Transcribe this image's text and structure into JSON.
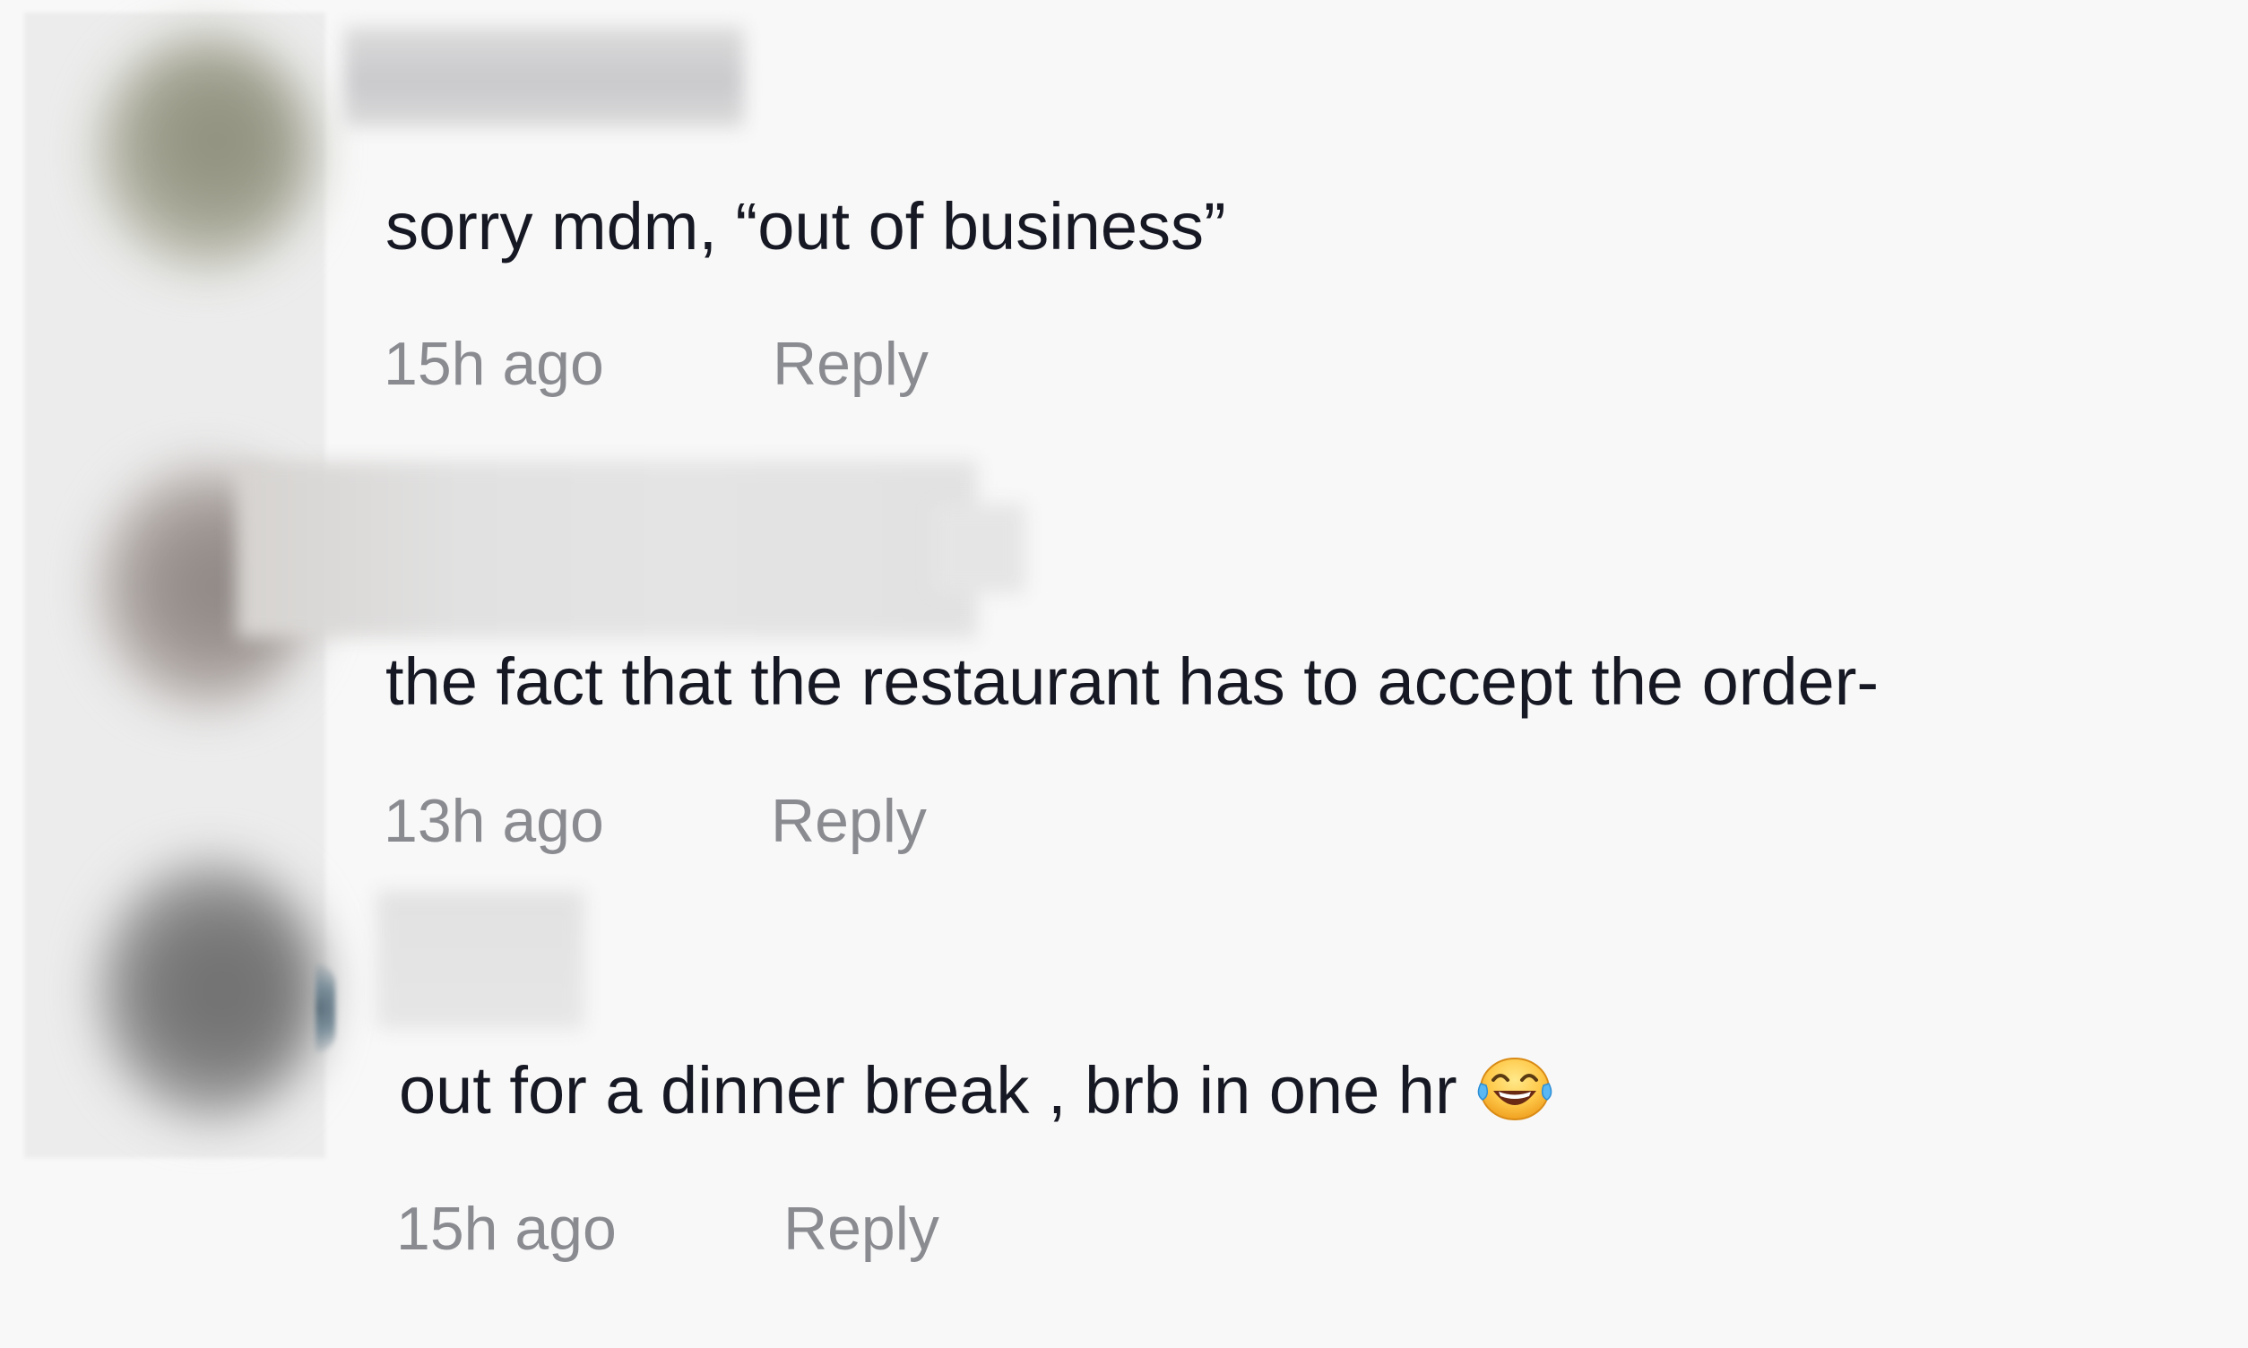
{
  "comments": [
    {
      "text": "sorry mdm, “out of business”",
      "time": "15h ago",
      "reply_label": "Reply"
    },
    {
      "text": "the fact that the restaurant has to accept the order-",
      "time": "13h ago",
      "reply_label": "Reply"
    },
    {
      "text": "out for a dinner break , brb in one hr",
      "time": "15h ago",
      "reply_label": "Reply",
      "emoji": "laughing-with-tears-emoji"
    }
  ],
  "colors": {
    "background": "#f8f8f8",
    "comment_text": "#161823",
    "meta_text": "#8a8b91"
  }
}
